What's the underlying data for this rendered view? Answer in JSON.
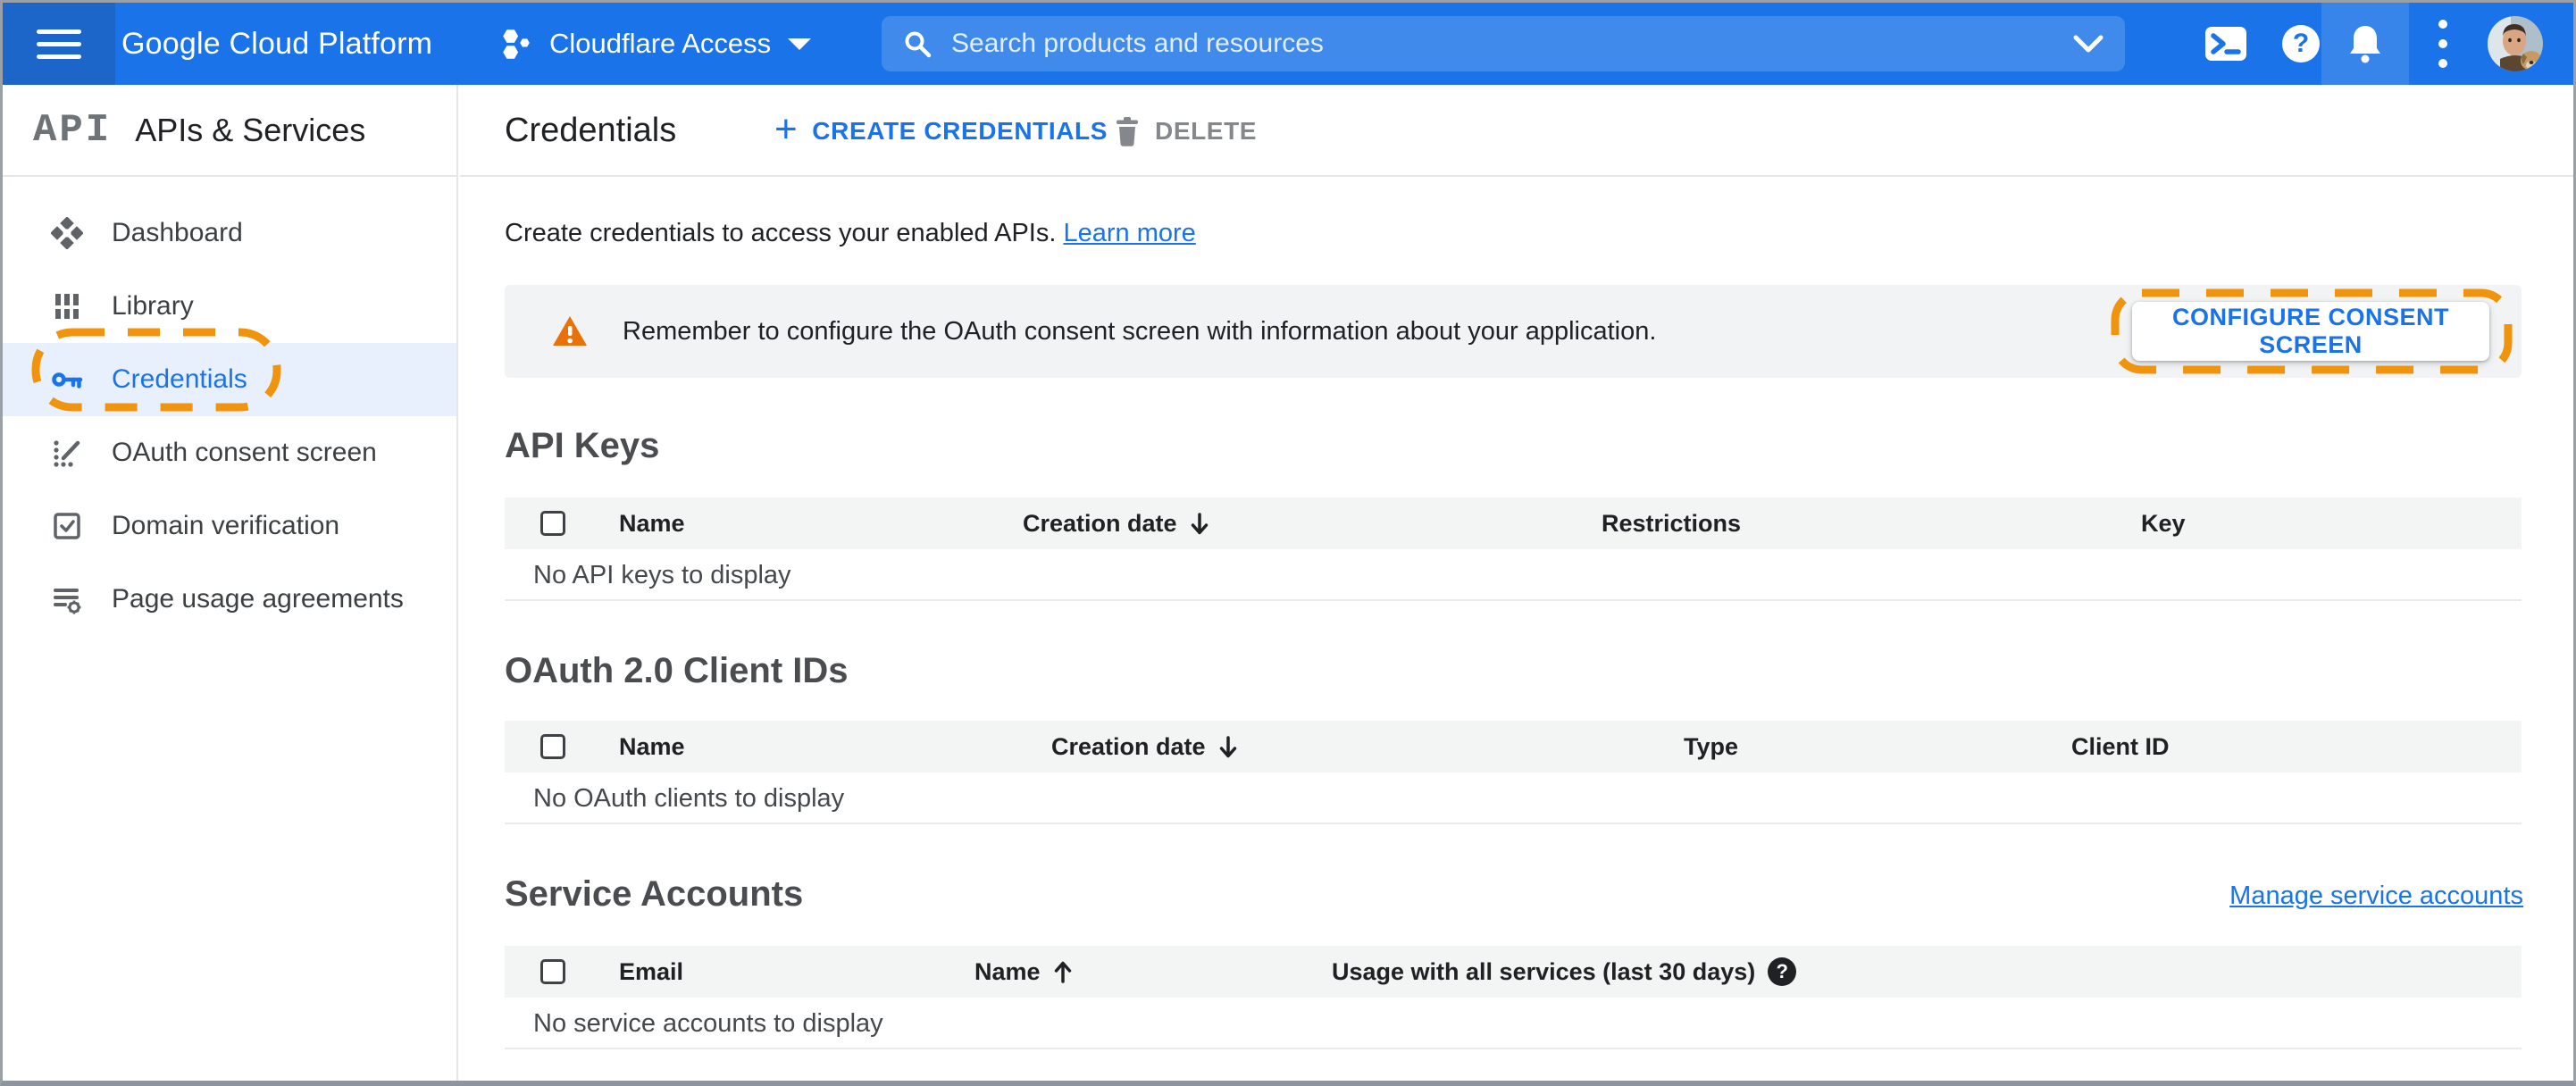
{
  "topbar": {
    "product_name": "Google Cloud Platform",
    "project_name": "Cloudflare Access",
    "search_placeholder": "Search products and resources",
    "help_glyph": "?"
  },
  "sidebar": {
    "logo_text": "API",
    "section_title": "APIs & Services",
    "items": [
      {
        "label": "Dashboard"
      },
      {
        "label": "Library"
      },
      {
        "label": "Credentials"
      },
      {
        "label": "OAuth consent screen"
      },
      {
        "label": "Domain verification"
      },
      {
        "label": "Page usage agreements"
      }
    ]
  },
  "page": {
    "title": "Credentials",
    "create_label": "CREATE CREDENTIALS",
    "create_plus": "+",
    "delete_label": "DELETE",
    "intro_text": "Create credentials to access your enabled APIs.",
    "intro_link": "Learn more",
    "banner_message": "Remember to configure the OAuth consent screen with information about your application.",
    "banner_button": "CONFIGURE CONSENT SCREEN"
  },
  "sections": {
    "api_keys": {
      "title": "API Keys",
      "columns": [
        "Name",
        "Creation date",
        "Restrictions",
        "Key"
      ],
      "sort": {
        "column": "Creation date",
        "direction": "desc"
      },
      "empty": "No API keys to display"
    },
    "oauth_clients": {
      "title": "OAuth 2.0 Client IDs",
      "columns": [
        "Name",
        "Creation date",
        "Type",
        "Client ID"
      ],
      "sort": {
        "column": "Creation date",
        "direction": "desc"
      },
      "empty": "No OAuth clients to display"
    },
    "service_accounts": {
      "title": "Service Accounts",
      "link": "Manage service accounts",
      "columns": [
        "Email",
        "Name",
        "Usage with all services (last 30 days)"
      ],
      "sort": {
        "column": "Name",
        "direction": "asc"
      },
      "empty": "No service accounts to display",
      "help_glyph": "?"
    }
  },
  "colors": {
    "accent_blue": "#1a73e8",
    "annotation_orange": "#f0930d",
    "warning_orange": "#e8710a",
    "selected_row_bg": "#e8f0fe",
    "banner_bg": "#f1f3f4"
  }
}
